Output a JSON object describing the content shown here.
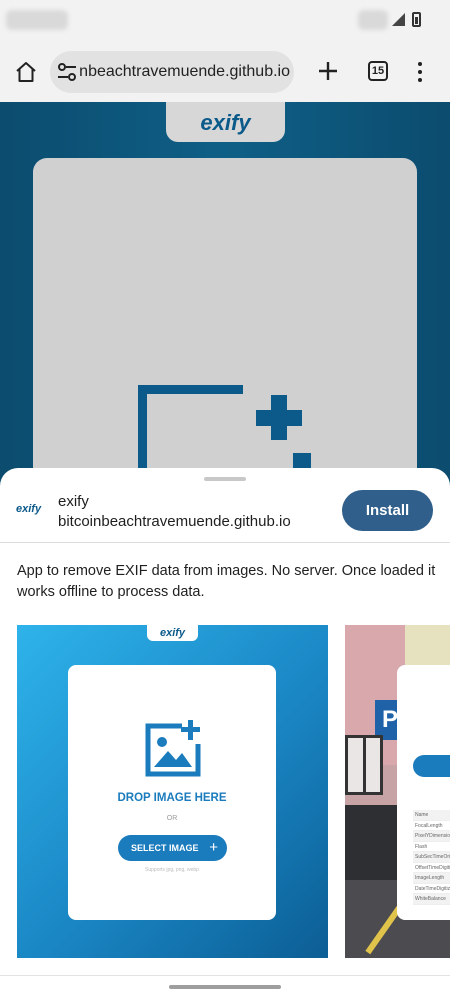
{
  "browser": {
    "url": "bitcoinbeachtravemuende.github.io",
    "tab_count": "15"
  },
  "page": {
    "logo_text": "exify"
  },
  "install_sheet": {
    "app_logo": "exify",
    "app_name": "exify",
    "app_origin": "bitcoinbeachtravemuende.github.io",
    "install_label": "Install",
    "description": "App to remove EXIF data from images. No server. Once loaded it works offline to process data.",
    "screenshots": [
      {
        "logo": "exify",
        "drop_label": "DROP IMAGE HERE",
        "or_label": "OR",
        "select_label": "SELECT IMAGE",
        "supports_label": "Supports jpg, png, webp"
      },
      {
        "sign": "P",
        "table_rows": [
          "Name",
          "FocalLength",
          "PixelYDimension",
          "Flash",
          "SubSecTimeOriginal",
          "OffsetTimeDigitized",
          "ImageLength",
          "DateTimeDigitized",
          "WhiteBalance"
        ]
      }
    ]
  },
  "colors": {
    "accent": "#2f5f8a",
    "brand_blue": "#1a7bbd",
    "page_bg": "#0e5e86"
  }
}
